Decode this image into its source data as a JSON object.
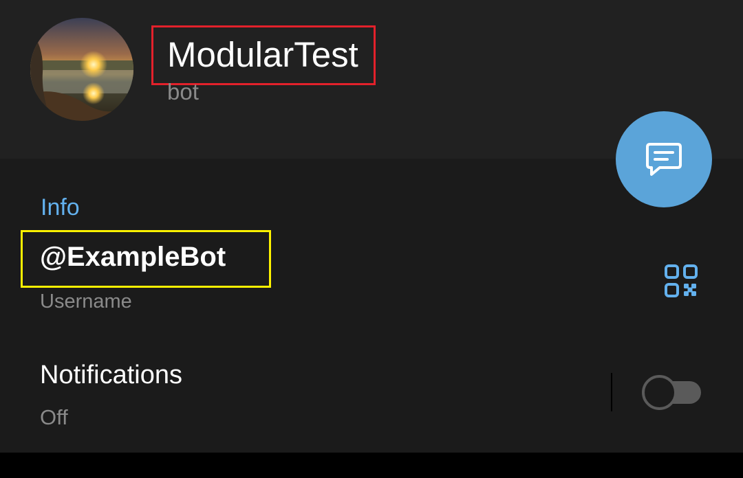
{
  "profile": {
    "name": "ModularTest",
    "subtitle": "bot",
    "avatar_icon": "sunset-landscape-avatar"
  },
  "fab": {
    "icon": "message-icon",
    "color": "#5ba4d9"
  },
  "info": {
    "section_title": "Info",
    "username": "@ExampleBot",
    "username_caption": "Username",
    "qr_icon": "qr-code-icon"
  },
  "notifications": {
    "label": "Notifications",
    "status": "Off",
    "enabled": false
  },
  "highlights": {
    "name_box_color": "#e3212b",
    "username_box_color": "#fdf200"
  },
  "colors": {
    "accent": "#63b1ee",
    "background": "#1b1b1b",
    "header_background": "#212121"
  }
}
